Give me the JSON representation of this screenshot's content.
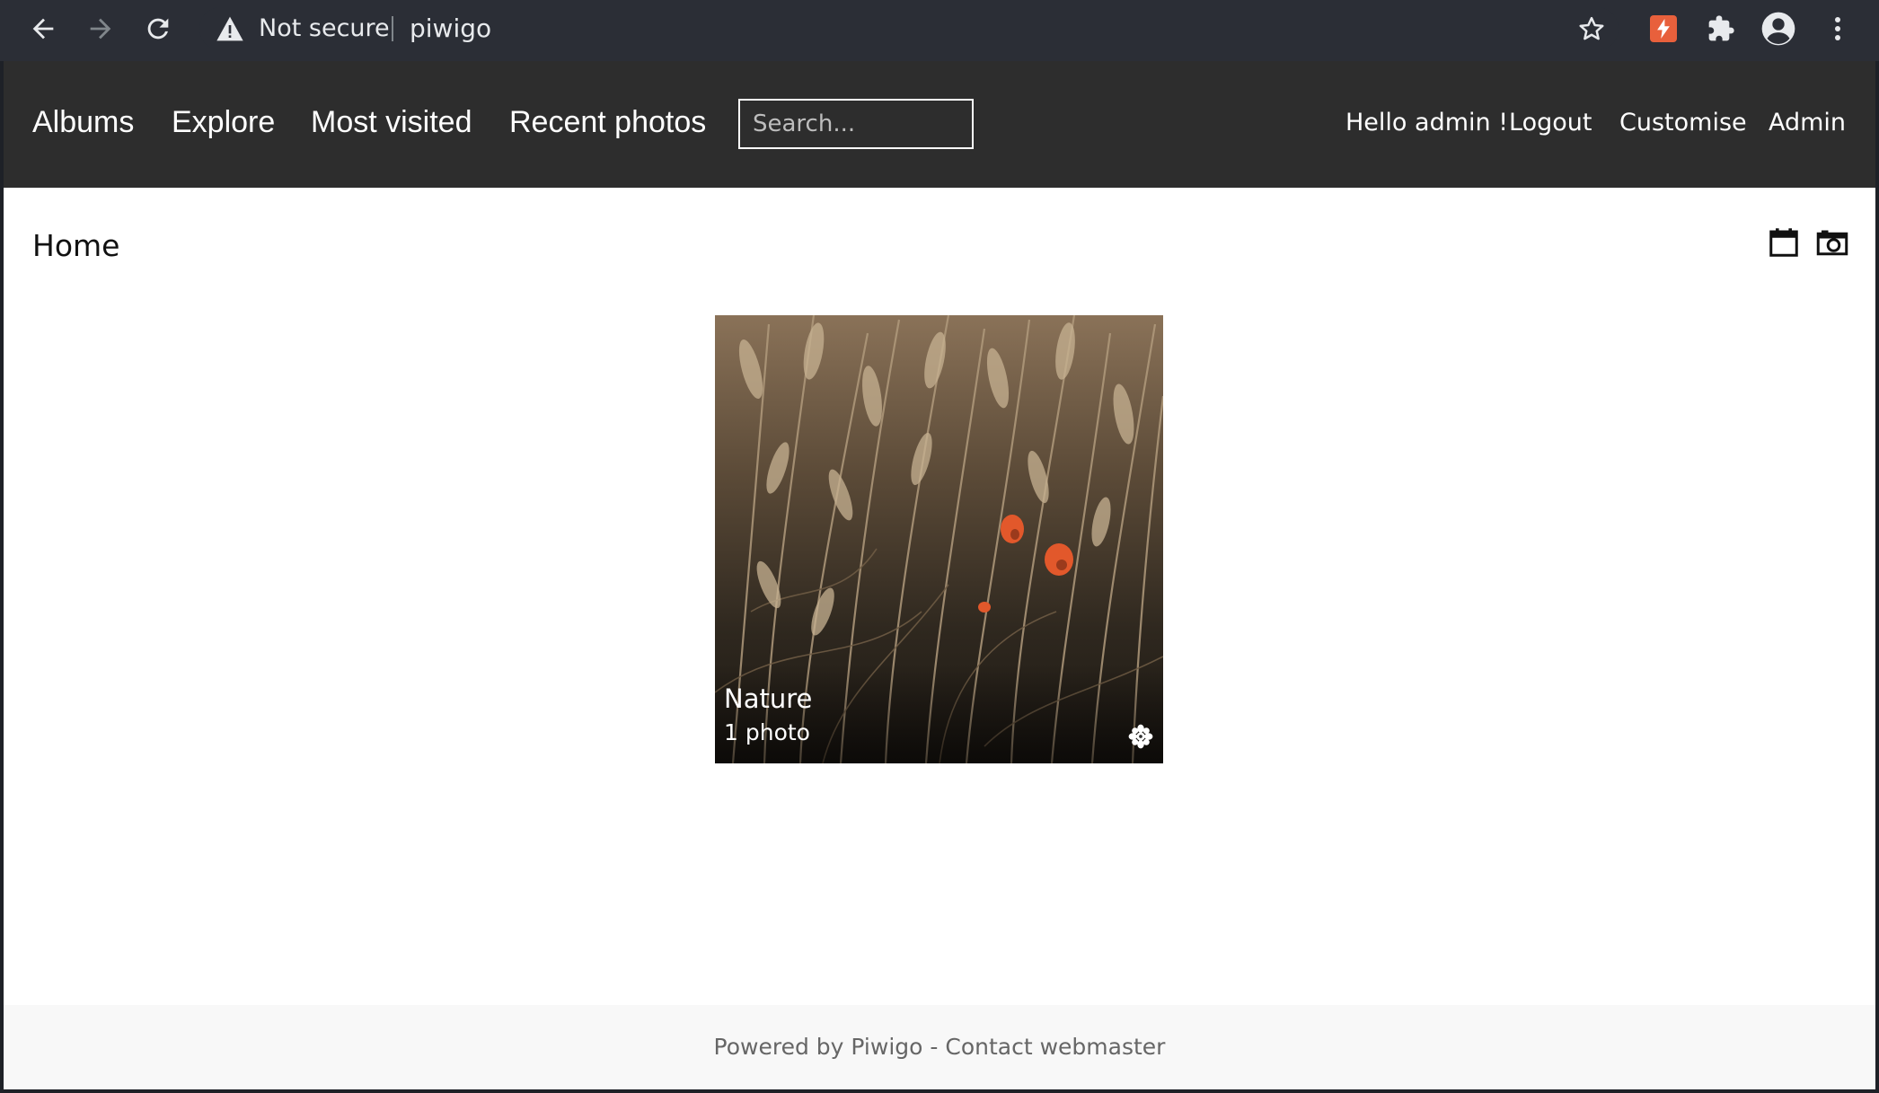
{
  "browser": {
    "security_label": "Not secure",
    "url": "piwigo",
    "icons": [
      "back-arrow-icon",
      "forward-arrow-icon",
      "reload-icon",
      "warning-icon",
      "star-icon",
      "extension-badge-icon",
      "puzzle-icon",
      "profile-icon",
      "kebab-menu-icon"
    ]
  },
  "nav": {
    "menu": [
      "Albums",
      "Explore",
      "Most visited",
      "Recent photos"
    ],
    "search_placeholder": "Search...",
    "greeting": "Hello admin !",
    "logout": "Logout",
    "customise": "Customise",
    "admin": "Admin"
  },
  "content": {
    "breadcrumb": "Home",
    "tools": [
      "calendar-icon",
      "camera-icon"
    ],
    "album": {
      "title": "Nature",
      "count": "1 photo",
      "recent_icon": "recent-star-icon"
    }
  },
  "footer": {
    "powered_by": "Powered by",
    "brand": "Piwigo",
    "separator": " - ",
    "contact": "Contact webmaster"
  },
  "colors": {
    "chrome_bg": "#2b2e36",
    "nav_bg": "#2d2d2d",
    "footer_bg": "#f8f8f8",
    "extension_badge": "#e8603c",
    "poppy": "#e2582b"
  }
}
